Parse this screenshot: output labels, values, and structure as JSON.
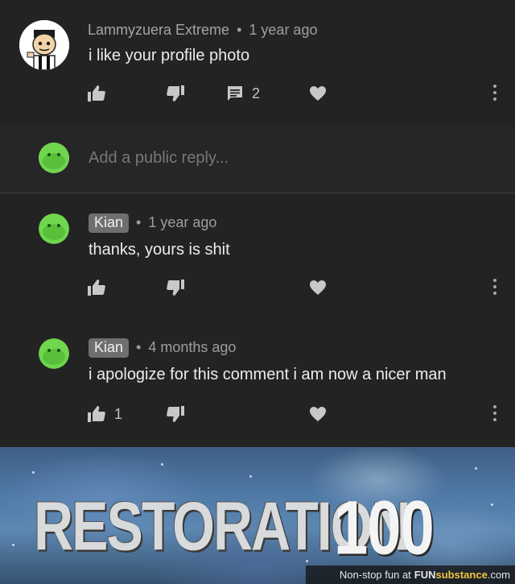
{
  "comments": [
    {
      "author": "Lammyzuera Extreme",
      "author_chip": false,
      "time": "1 year ago",
      "text": "i like your profile photo",
      "like_count": "",
      "reply_count": "2",
      "avatar_icon": "cartoon-avatar-icon"
    },
    {
      "author": "Kian",
      "author_chip": true,
      "time": "1 year ago",
      "text": "thanks, yours is shit",
      "like_count": "",
      "avatar_icon": "green-blob-avatar-icon"
    },
    {
      "author": "Kian",
      "author_chip": true,
      "time": "4 months ago",
      "text": "i apologize for this comment i am now a nicer man",
      "like_count": "1",
      "avatar_icon": "green-blob-avatar-icon"
    }
  ],
  "reply": {
    "placeholder": "Add a public reply..."
  },
  "banner": {
    "word": "RESTORATION",
    "number": "100"
  },
  "footer": {
    "text": "Non-stop fun at",
    "brand_part1": "FUN",
    "brand_part2": "substance",
    "brand_part3": ".com"
  },
  "colors": {
    "background": "#232323",
    "green_avatar": "#6fd64e",
    "chip": "#6f6f6f",
    "footer_accent": "#f4c542"
  }
}
